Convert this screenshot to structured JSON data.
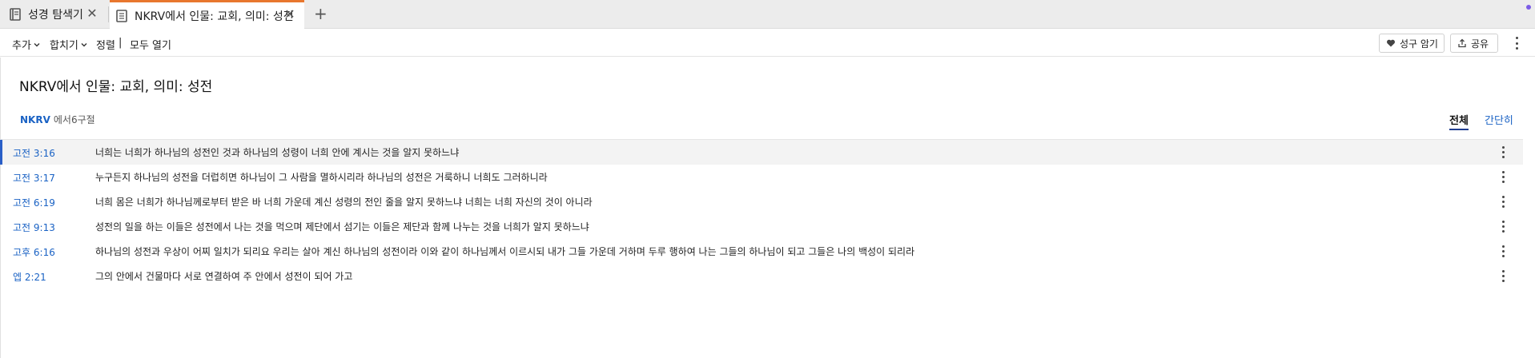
{
  "tabs": [
    {
      "label": "성경 탐색기",
      "icon": "book-icon",
      "active": false
    },
    {
      "label": "NKRV에서 인물: 교회, 의미: 성전",
      "icon": "bookmark-book-icon",
      "active": true
    }
  ],
  "colors": {
    "accent": "#1a62c4",
    "tab_active_border": "#e8772e",
    "active_row_bar": "#2a5fc7",
    "notification_dot": "#7b5ce6"
  },
  "toolbar": {
    "add_label": "추가",
    "merge_label": "합치기",
    "sort_label": "정렬",
    "separator": "|",
    "open_all_label": "모두 열기",
    "memorize_label": "성구 암기",
    "share_label": "공유"
  },
  "main": {
    "title": "NKRV에서 인물: 교회, 의미: 성전",
    "version": "NKRV",
    "count_text": "에서6구절",
    "view_full": "전체",
    "view_brief": "간단히"
  },
  "results": [
    {
      "ref": "고전 3:16",
      "text": "너희는 너희가 하나님의 성전인 것과 하나님의 성령이 너희 안에 계시는 것을 알지 못하느냐"
    },
    {
      "ref": "고전 3:17",
      "text": "누구든지 하나님의 성전을 더럽히면 하나님이 그 사람을 멸하시리라 하나님의 성전은 거룩하니 너희도 그러하니라"
    },
    {
      "ref": "고전 6:19",
      "text": "너희 몸은 너희가 하나님께로부터 받은 바 너희 가운데 계신 성령의 전인 줄을 알지 못하느냐 너희는 너희 자신의 것이 아니라"
    },
    {
      "ref": "고전 9:13",
      "text": "성전의 일을 하는 이들은 성전에서 나는 것을 먹으며 제단에서 섬기는 이들은 제단과 함께 나누는 것을 너희가 알지 못하느냐"
    },
    {
      "ref": "고후 6:16",
      "text": "하나님의 성전과 우상이 어찌 일치가 되리요 우리는 살아 계신 하나님의 성전이라 이와 같이 하나님께서 이르시되 내가 그들 가운데 거하며 두루 행하여 나는 그들의 하나님이 되고 그들은 나의 백성이 되리라"
    },
    {
      "ref": "엡 2:21",
      "text": "그의 안에서 건물마다 서로 연결하여 주 안에서 성전이 되어 가고"
    }
  ]
}
